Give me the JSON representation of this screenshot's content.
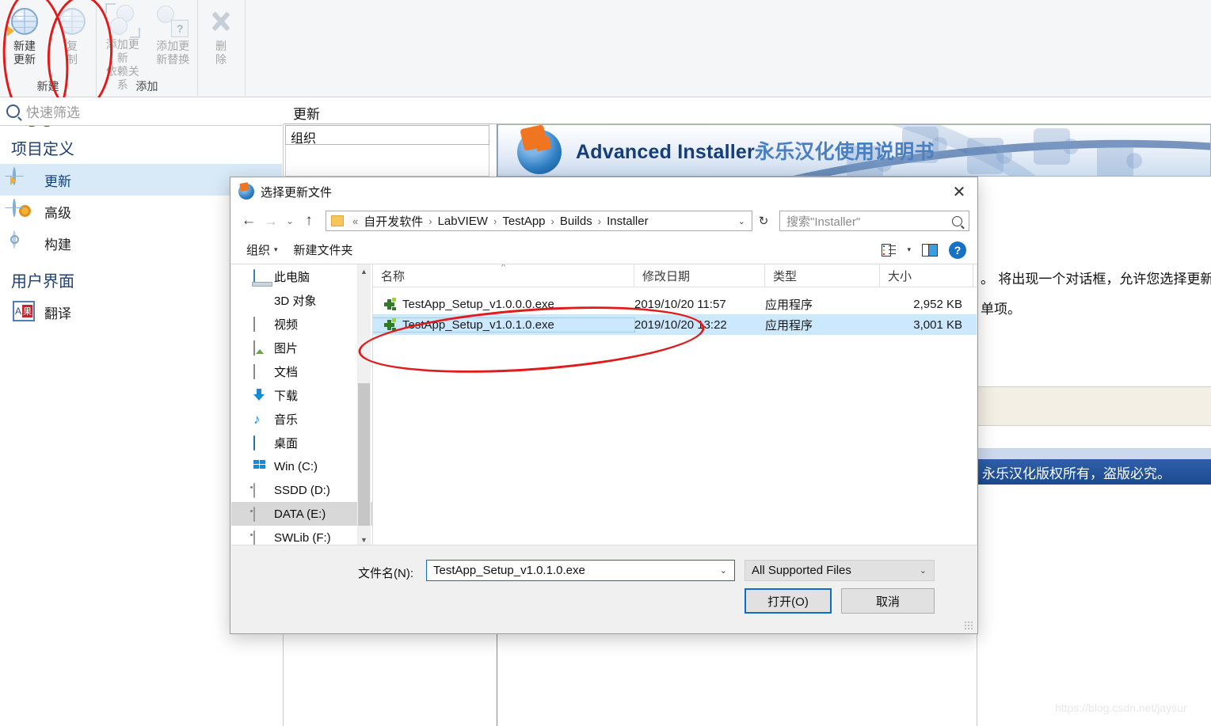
{
  "ribbon": {
    "groups": [
      {
        "caption": "新建",
        "buttons": [
          {
            "label": "新建\n更新",
            "icon": "globe-star-icon",
            "disabled": false
          },
          {
            "label": "复\n制",
            "icon": "globe-copy-icon",
            "disabled": true
          }
        ]
      },
      {
        "caption": "添加",
        "buttons": [
          {
            "label": "添加更新\n依赖关系",
            "icon": "add-update-dependency-icon",
            "disabled": true
          },
          {
            "label": "添加更\n新替换",
            "icon": "add-update-replace-icon",
            "disabled": true
          }
        ]
      },
      {
        "caption": "",
        "buttons": [
          {
            "label": "删\n除",
            "icon": "delete-x-icon",
            "disabled": true
          }
        ]
      }
    ]
  },
  "quick_filter": {
    "placeholder": "快速筛选",
    "icon": "search-icon"
  },
  "project_tree": {
    "sections": [
      {
        "heading": "项目定义",
        "items": [
          {
            "label": "更新",
            "icon": "globe-star-icon",
            "selected": true
          },
          {
            "label": "高级",
            "icon": "globe-gear-icon",
            "selected": false
          },
          {
            "label": "构建",
            "icon": "disc-icon",
            "selected": false
          }
        ]
      },
      {
        "heading": "用户界面",
        "items": [
          {
            "label": "翻译",
            "icon": "translate-icon",
            "selected": false
          }
        ]
      }
    ]
  },
  "content": {
    "title": "更新",
    "org_box": "组织",
    "banner": {
      "brand": "Advanced Installer",
      "suffix": "永乐汉化使用说明书"
    },
    "doc_lines": [
      "。 将出现一个对话框，允许您选择更新",
      "单项。"
    ],
    "footer_banner": "永乐汉化版权所有，盗版必究。",
    "watermark": "https://blog.csdn.net/jaysur"
  },
  "dialog": {
    "title": "选择更新文件",
    "close_label": "✕",
    "nav": {
      "back": "←",
      "forward": "→",
      "recent": "⌄",
      "up": "↑",
      "breadcrumb_prefix": "«",
      "breadcrumb": [
        "自开发软件",
        "LabVIEW",
        "TestApp",
        "Builds",
        "Installer"
      ],
      "breadcrumb_separator": "›",
      "address_caret": "⌄",
      "refresh": "↻",
      "search_placeholder": "搜索\"Installer\"",
      "search_icon": "search-icon"
    },
    "commands": {
      "organize": "组织",
      "organize_caret": "▾",
      "new_folder": "新建文件夹",
      "view_icon": "view-options-icon",
      "view_caret": "▾",
      "preview_icon": "preview-pane-icon",
      "help_icon": "help-icon",
      "help_label": "?"
    },
    "navigation_pane": [
      {
        "label": "此电脑",
        "icon": "this-pc-icon",
        "selected": false
      },
      {
        "label": "3D 对象",
        "icon": "3d-objects-icon",
        "selected": false
      },
      {
        "label": "视频",
        "icon": "videos-icon",
        "selected": false
      },
      {
        "label": "图片",
        "icon": "pictures-icon",
        "selected": false
      },
      {
        "label": "文档",
        "icon": "documents-icon",
        "selected": false
      },
      {
        "label": "下载",
        "icon": "downloads-icon",
        "selected": false
      },
      {
        "label": "音乐",
        "icon": "music-icon",
        "selected": false
      },
      {
        "label": "桌面",
        "icon": "desktop-icon",
        "selected": false
      },
      {
        "label": "Win (C:)",
        "icon": "windows-drive-icon",
        "selected": false
      },
      {
        "label": "SSDD (D:)",
        "icon": "drive-icon",
        "selected": false
      },
      {
        "label": "DATA (E:)",
        "icon": "drive-icon",
        "selected": true
      },
      {
        "label": "SWLib (F:)",
        "icon": "drive-icon",
        "selected": false
      }
    ],
    "file_list": {
      "columns": [
        "名称",
        "修改日期",
        "类型",
        "大小"
      ],
      "sort_indicator": "^",
      "sort_column": "名称",
      "rows": [
        {
          "name": "TestApp_Setup_v1.0.0.0.exe",
          "modified": "2019/10/20 11:57",
          "type": "应用程序",
          "size": "2,952 KB",
          "icon": "exe-file-icon",
          "selected": false
        },
        {
          "name": "TestApp_Setup_v1.0.1.0.exe",
          "modified": "2019/10/20 13:22",
          "type": "应用程序",
          "size": "3,001 KB",
          "icon": "exe-file-icon",
          "selected": true
        }
      ]
    },
    "footer": {
      "filename_label": "文件名(N):",
      "filename_value": "TestApp_Setup_v1.0.1.0.exe",
      "filename_caret": "⌄",
      "filter_value": "All Supported Files",
      "filter_caret": "⌄",
      "open_button": "打开(O)",
      "cancel_button": "取消"
    }
  },
  "colors": {
    "accent": "#0b6fc4",
    "selection": "#cce8ff",
    "annotation": "#e01b1b",
    "tree_selection": "#d8e9f8",
    "banner_blue": "#1c4a90"
  }
}
